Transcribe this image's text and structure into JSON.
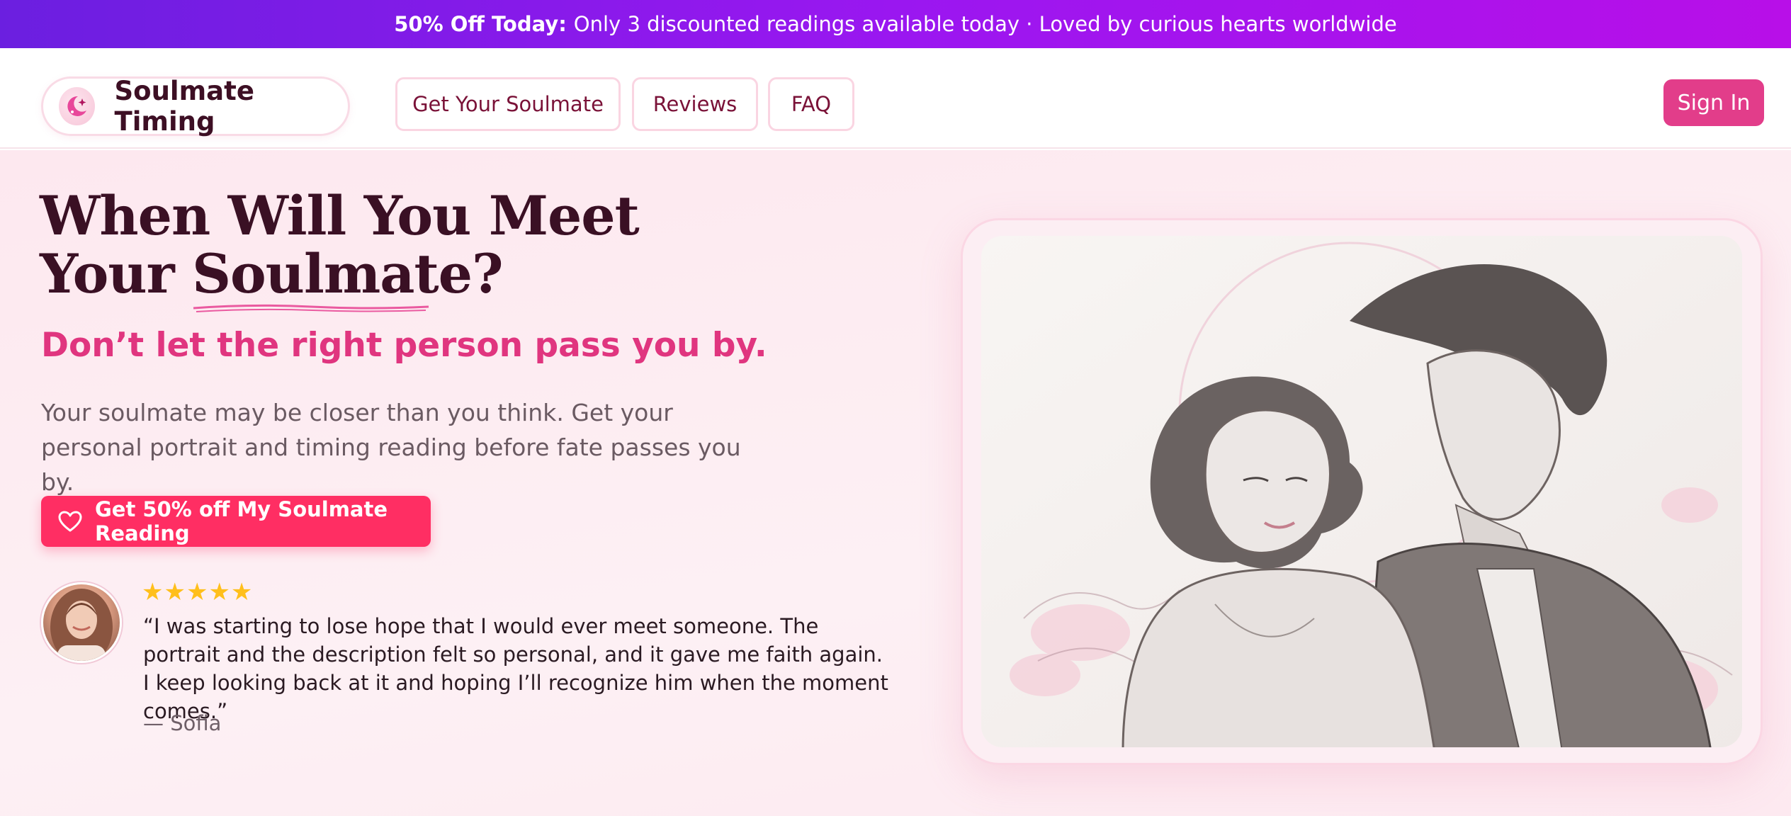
{
  "banner": {
    "bold": "50% Off Today:",
    "text": "Only 3 discounted readings available today · Loved by curious hearts worldwide"
  },
  "header": {
    "brand": "Soulmate Timing",
    "nav": [
      "Get Your Soulmate",
      "Reviews",
      "FAQ"
    ],
    "sign_in": "Sign In"
  },
  "hero": {
    "headline_line1": "When Will You Meet",
    "headline_line2_prefix": "Your ",
    "headline_line2_highlight": "Soulmate",
    "headline_line2_suffix": "?",
    "subheadline": "Don’t let the right person pass you by.",
    "description": "Your soulmate may be closer than you think. Get your personal portrait and timing reading before fate passes you by.",
    "cta_label": "Get 50% off My Soulmate Reading",
    "testimonial": {
      "stars": "★★★★★",
      "rating": 5,
      "quote": "“I was starting to lose hope that I would ever meet someone. The portrait and the description felt so personal, and it gave me faith again. I keep looking back at it and hoping I’ll recognize him when the moment comes.”",
      "author": "— Sofia"
    }
  },
  "colors": {
    "banner_gradient_start": "#6b1fe0",
    "banner_gradient_end": "#b80fe8",
    "accent_pink": "#e0357f",
    "cta_red": "#ff2e63",
    "sign_in_bg": "#e23d8a",
    "headline_text": "#3a1024",
    "star_gold": "#ffbf1c"
  },
  "icons": {
    "brand": "crescent-moon-sparkle-icon",
    "cta": "heart-icon"
  }
}
